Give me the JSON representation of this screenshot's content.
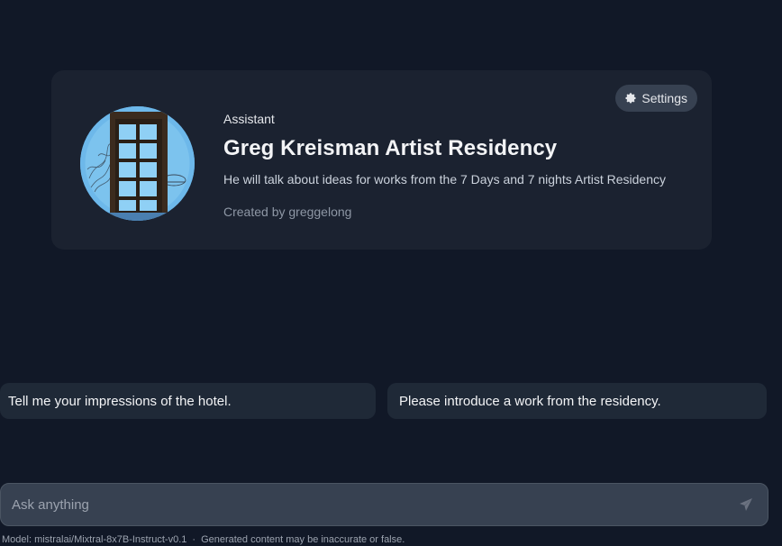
{
  "assistant_card": {
    "type_label": "Assistant",
    "name": "Greg Kreisman Artist Residency",
    "description": "He will talk about ideas for works from the 7 Days and 7 nights Artist Residency",
    "created_by": "Created by greggelong",
    "avatar_icon": "window-frame-sculpture-image",
    "settings_label": "Settings",
    "settings_icon": "gear-icon"
  },
  "suggestions": [
    "Tell me your impressions of the hotel.",
    "Please introduce a work from the residency."
  ],
  "chat_input": {
    "placeholder": "Ask anything",
    "send_icon": "send-icon"
  },
  "footer": {
    "model_text": "Model: mistralai/Mixtral-8x7B-Instruct-v0.1",
    "disclaimer": "Generated content may be inaccurate or false."
  },
  "colors": {
    "background": "#111827",
    "card": "#1b2230",
    "suggestion": "#1f2937",
    "input": "#374151"
  }
}
